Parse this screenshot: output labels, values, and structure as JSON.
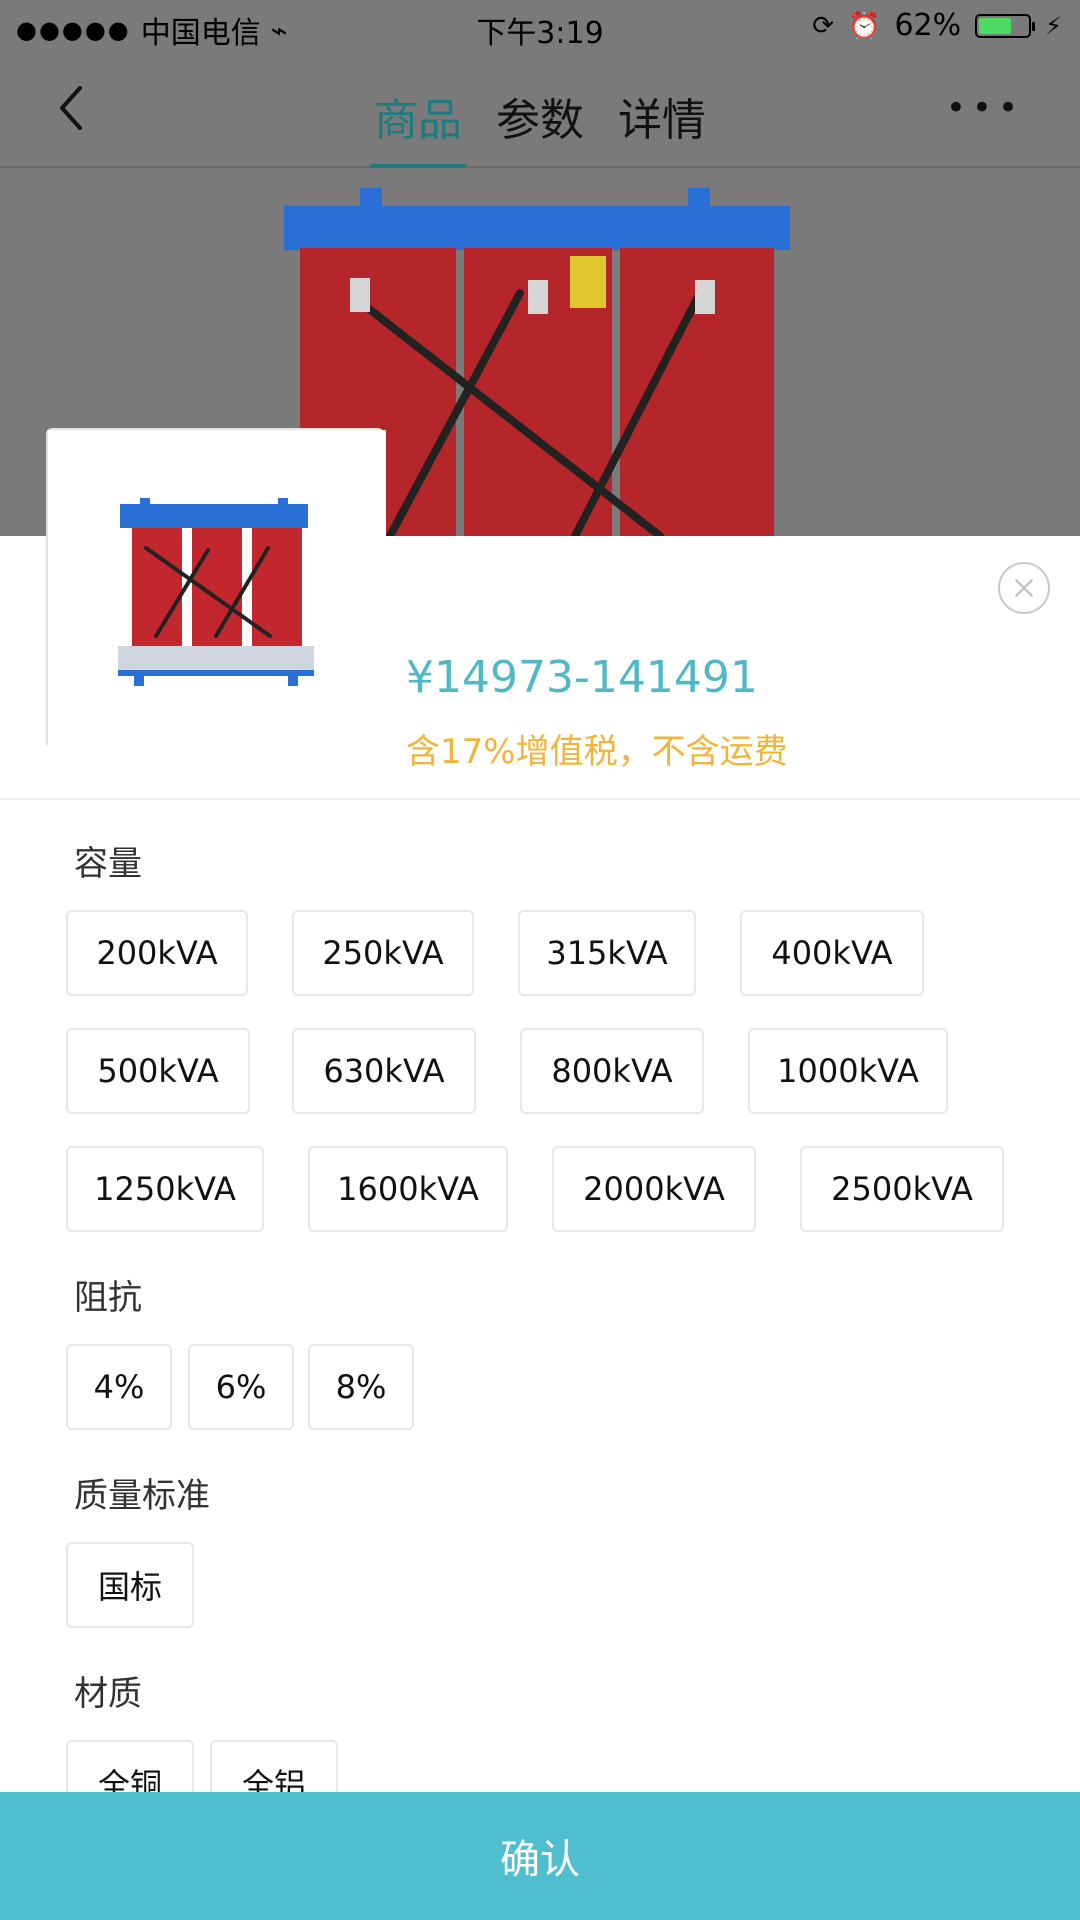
{
  "status_bar": {
    "signal": "●●●●●",
    "carrier": "中国电信",
    "time": "下午3:19",
    "battery": "62%"
  },
  "navbar": {
    "tabs": [
      {
        "label": "商品",
        "active": true
      },
      {
        "label": "参数",
        "active": false
      },
      {
        "label": "详情",
        "active": false
      }
    ],
    "more_label": "•••"
  },
  "product": {
    "price": "¥14973-141491",
    "tax_note": "含17%增值税，不含运费"
  },
  "sections": {
    "capacity": {
      "title": "容量",
      "options": [
        "200kVA",
        "250kVA",
        "315kVA",
        "400kVA",
        "500kVA",
        "630kVA",
        "800kVA",
        "1000kVA",
        "1250kVA",
        "1600kVA",
        "2000kVA",
        "2500kVA"
      ]
    },
    "impedance": {
      "title": "阻抗",
      "options": [
        "4%",
        "6%",
        "8%"
      ]
    },
    "quality": {
      "title": "质量标准",
      "options": [
        "国标"
      ]
    },
    "material": {
      "title": "材质",
      "options": [
        "全铜",
        "全铝"
      ]
    }
  },
  "footer": {
    "confirm_label": "确认"
  },
  "colors": {
    "accent": "#4fbfcf",
    "price": "#4fb8c5",
    "tax": "#f0b43a",
    "tab_active": "#1f7b7f"
  }
}
